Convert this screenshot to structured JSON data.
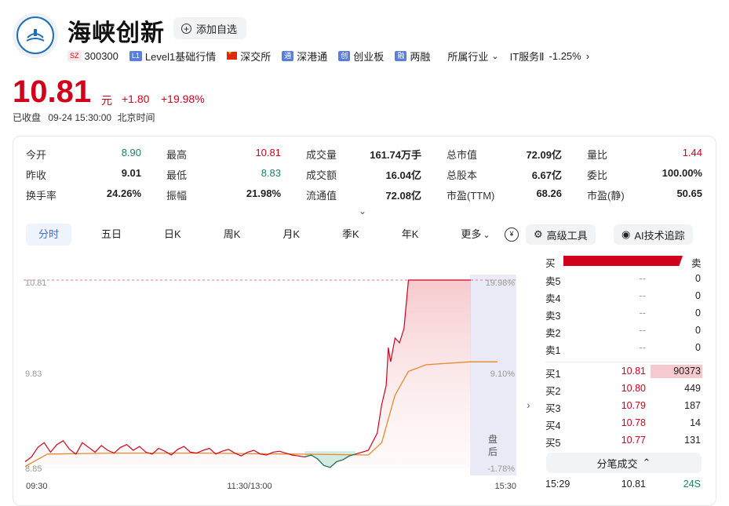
{
  "stock": {
    "name": "海峡创新",
    "add_watch_label": "添加自选",
    "exchange_badge": "SZ",
    "code": "300300",
    "level_badge": "L1",
    "level_label": "Level1基础行情",
    "exchange_label": "深交所",
    "connect_badge": "通",
    "connect_label": "深港通",
    "board_badge": "创",
    "board_label": "创业板",
    "margin_badge": "融",
    "margin_label": "两融",
    "industry_label": "所属行业",
    "industry_value": "IT服务Ⅱ",
    "industry_change": "-1.25%"
  },
  "quote": {
    "price": "10.81",
    "unit": "元",
    "change": "+1.80",
    "change_pct": "+19.98%",
    "status": "已收盘",
    "time": "09-24 15:30:00",
    "tz": "北京时间"
  },
  "stats": [
    {
      "label": "今开",
      "value": "8.90",
      "color": "green"
    },
    {
      "label": "最高",
      "value": "10.81",
      "color": "red"
    },
    {
      "label": "成交量",
      "value": "161.74万手",
      "color": "normal"
    },
    {
      "label": "总市值",
      "value": "72.09亿",
      "color": "normal"
    },
    {
      "label": "量比",
      "value": "1.44",
      "color": "red"
    },
    {
      "label": "昨收",
      "value": "9.01",
      "color": "normal"
    },
    {
      "label": "最低",
      "value": "8.83",
      "color": "green"
    },
    {
      "label": "成交额",
      "value": "16.04亿",
      "color": "normal"
    },
    {
      "label": "总股本",
      "value": "6.67亿",
      "color": "normal"
    },
    {
      "label": "委比",
      "value": "100.00%",
      "color": "normal"
    },
    {
      "label": "换手率",
      "value": "24.26%",
      "color": "normal"
    },
    {
      "label": "振幅",
      "value": "21.98%",
      "color": "normal"
    },
    {
      "label": "流通值",
      "value": "72.08亿",
      "color": "normal"
    },
    {
      "label": "市盈(TTM)",
      "value": "68.26",
      "color": "normal"
    },
    {
      "label": "市盈(静)",
      "value": "50.65",
      "color": "normal"
    }
  ],
  "tabs": [
    "分时",
    "五日",
    "日K",
    "周K",
    "月K",
    "季K",
    "年K",
    "更多"
  ],
  "tools": {
    "advanced": "高级工具",
    "ai": "AI技术追踪"
  },
  "chart": {
    "price_top": "10.81",
    "price_mid": "9.83",
    "price_bot": "8.85",
    "pct_top": "19.98%",
    "pct_mid": "9.10%",
    "pct_bot": "-1.78%",
    "time_start": "09:30",
    "time_mid": "11:30/13:00",
    "time_end": "15:30",
    "after_hours": "盘后"
  },
  "order_book": {
    "buy_label": "买",
    "sell_label": "卖",
    "asks": [
      {
        "label": "卖5",
        "price": "--",
        "vol": "0"
      },
      {
        "label": "卖4",
        "price": "--",
        "vol": "0"
      },
      {
        "label": "卖3",
        "price": "--",
        "vol": "0"
      },
      {
        "label": "卖2",
        "price": "--",
        "vol": "0"
      },
      {
        "label": "卖1",
        "price": "--",
        "vol": "0"
      }
    ],
    "bids": [
      {
        "label": "买1",
        "price": "10.81",
        "vol": "90373"
      },
      {
        "label": "买2",
        "price": "10.80",
        "vol": "449"
      },
      {
        "label": "买3",
        "price": "10.79",
        "vol": "187"
      },
      {
        "label": "买4",
        "price": "10.78",
        "vol": "14"
      },
      {
        "label": "买5",
        "price": "10.77",
        "vol": "131"
      }
    ],
    "trades_label": "分笔成交",
    "trades": [
      {
        "time": "15:29",
        "price": "10.81",
        "vol": "24S"
      }
    ]
  },
  "colors": {
    "up": "#d0021b",
    "down": "#1a7f64",
    "avg": "#e8892b",
    "accent": "#3a6fd8"
  }
}
